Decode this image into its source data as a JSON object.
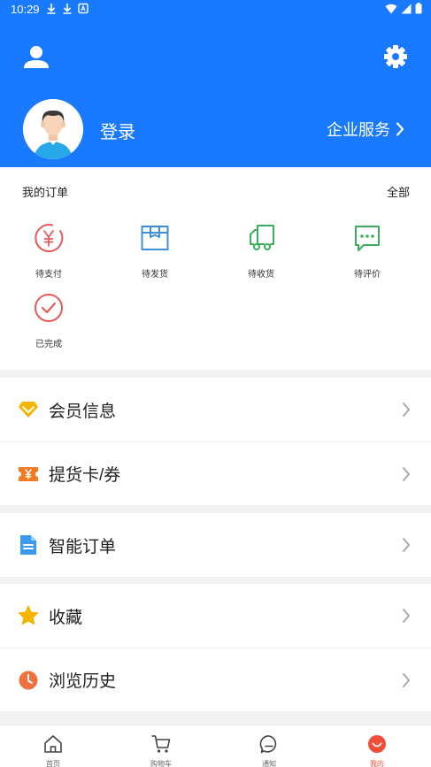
{
  "status_bar": {
    "time": "10:29"
  },
  "header": {
    "login_label": "登录",
    "enterprise_label": "企业服务"
  },
  "orders": {
    "title": "我的订单",
    "all_label": "全部",
    "items": [
      {
        "label": "待支付",
        "icon": "yen-circle-icon",
        "color": "#e35b5b"
      },
      {
        "label": "待发货",
        "icon": "package-box-icon",
        "color": "#3f8ed8"
      },
      {
        "label": "待收货",
        "icon": "delivery-truck-icon",
        "color": "#3aae5e"
      },
      {
        "label": "待评价",
        "icon": "chat-bubble-icon",
        "color": "#3aae5e"
      },
      {
        "label": "已完成",
        "icon": "check-circle-icon",
        "color": "#e35b5b"
      }
    ]
  },
  "menu": {
    "membership": "会员信息",
    "pickup_card": "提货卡/券",
    "smart_order": "智能订单",
    "favorites": "收藏",
    "history": "浏览历史"
  },
  "tabbar": {
    "home": "首页",
    "cart": "购物车",
    "notice": "通知",
    "mine": "我的"
  },
  "colors": {
    "brand_blue": "#1979ff",
    "active_red": "#f04d3a"
  }
}
